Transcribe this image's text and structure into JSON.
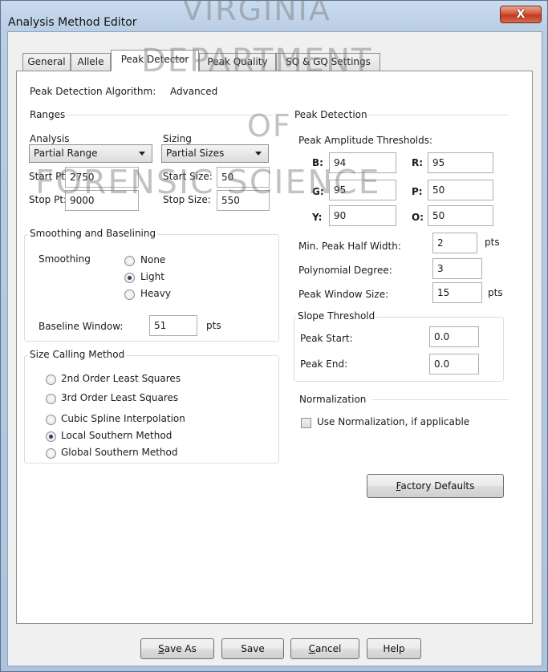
{
  "window": {
    "title": "Analysis Method Editor",
    "close_glyph": "X"
  },
  "tabs": [
    {
      "label": "General"
    },
    {
      "label": "Allele"
    },
    {
      "label": "Peak Detector"
    },
    {
      "label": "Peak Quality"
    },
    {
      "label": "SQ & GQ Settings"
    }
  ],
  "algorithm": {
    "label": "Peak Detection Algorithm:",
    "value": "Advanced"
  },
  "ranges": {
    "label": "Ranges",
    "analysis_label": "Analysis",
    "analysis_value": "Partial Range",
    "sizing_label": "Sizing",
    "sizing_value": "Partial Sizes",
    "start_pt_label": "Start Pt:",
    "start_pt_value": "2750",
    "stop_pt_label": "Stop Pt:",
    "stop_pt_value": "9000",
    "start_size_label": "Start Size:",
    "start_size_value": "50",
    "stop_size_label": "Stop Size:",
    "stop_size_value": "550"
  },
  "smoothing": {
    "group_label": "Smoothing and Baselining",
    "smoothing_label": "Smoothing",
    "options": [
      {
        "label": "None",
        "checked": false
      },
      {
        "label": "Light",
        "checked": true
      },
      {
        "label": "Heavy",
        "checked": false
      }
    ],
    "baseline_label": "Baseline Window:",
    "baseline_value": "51",
    "baseline_unit": "pts"
  },
  "size_calling": {
    "group_label": "Size Calling Method",
    "options": [
      {
        "label": "2nd Order Least Squares",
        "checked": false
      },
      {
        "label": "3rd Order Least Squares",
        "checked": false
      },
      {
        "label": "Cubic Spline Interpolation",
        "checked": false
      },
      {
        "label": "Local Southern Method",
        "checked": true
      },
      {
        "label": "Global Southern Method",
        "checked": false
      }
    ]
  },
  "peak_detection": {
    "label": "Peak Detection",
    "thresholds_label": "Peak Amplitude Thresholds:",
    "b_label": "B:",
    "b_value": "94",
    "r_label": "R:",
    "r_value": "95",
    "g_label": "G:",
    "g_value": "95",
    "p_label": "P:",
    "p_value": "50",
    "y_label": "Y:",
    "y_value": "90",
    "o_label": "O:",
    "o_value": "50",
    "min_half_width_label": "Min. Peak Half Width:",
    "min_half_width_value": "2",
    "min_half_width_unit": "pts",
    "poly_degree_label": "Polynomial Degree:",
    "poly_degree_value": "3",
    "window_size_label": "Peak Window Size:",
    "window_size_value": "15",
    "window_size_unit": "pts"
  },
  "slope": {
    "group_label": "Slope Threshold",
    "start_label": "Peak Start:",
    "start_value": "0.0",
    "end_label": "Peak End:",
    "end_value": "0.0"
  },
  "normalization": {
    "label": "Normalization",
    "checkbox_label": "Use Normalization, if applicable",
    "checked": false
  },
  "factory_defaults": {
    "prefix": "",
    "accel": "F",
    "rest": "actory Defaults"
  },
  "buttons": {
    "save_as": {
      "accel": "S",
      "rest": "ave As"
    },
    "save": {
      "label": "Save"
    },
    "cancel": {
      "accel": "C",
      "rest": "ancel"
    },
    "help": {
      "label": "Help"
    }
  },
  "watermark": {
    "line1": "VIRGINIA",
    "line2": "DEPARTMENT",
    "line3": "OF",
    "line4": "FORENSIC SCIENCE"
  }
}
